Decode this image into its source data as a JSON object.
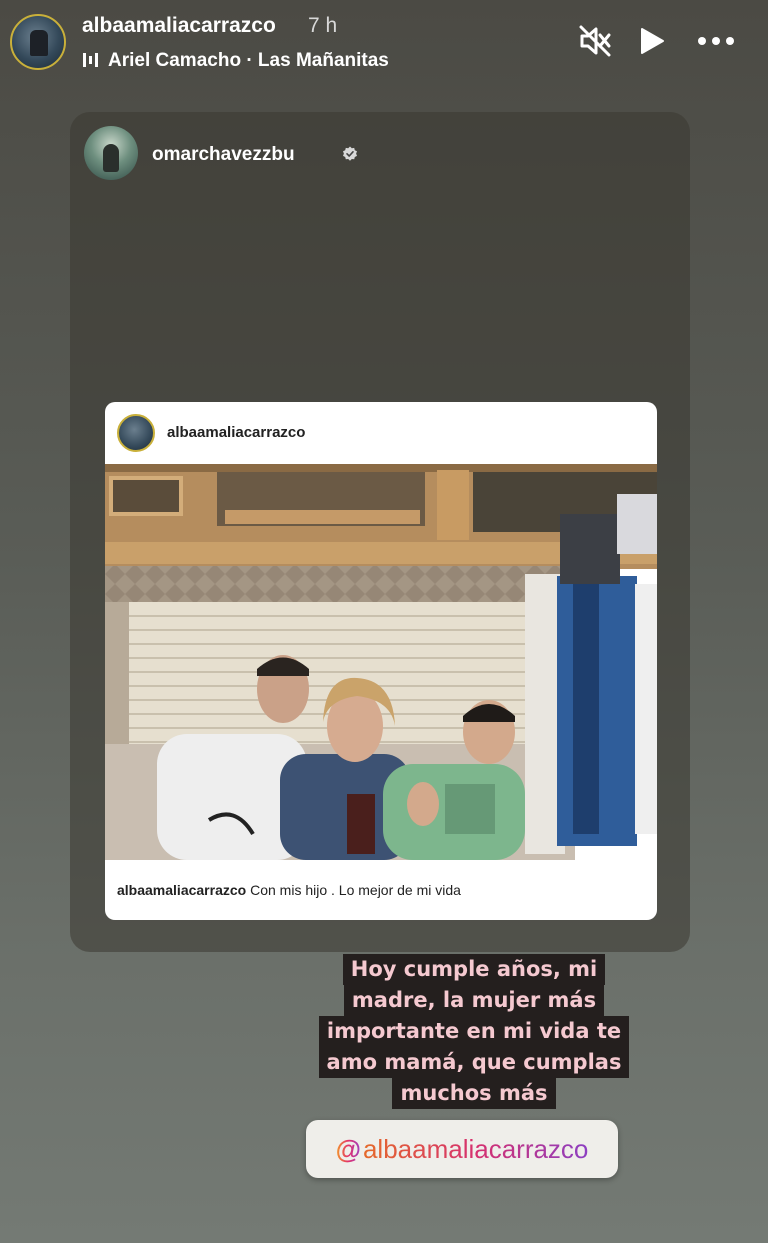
{
  "story": {
    "username": "albaamaliacarrazco",
    "time": "7 h",
    "music": "Ariel Camacho · Las Mañanitas",
    "icons": {
      "mute": "speaker-mute-icon",
      "play": "play-icon",
      "more": "more-options-icon",
      "music": "music-bars-icon"
    }
  },
  "shared_post": {
    "author": "omarchavezzbu",
    "verified": true,
    "embedded": {
      "username": "albaamaliacarrazco",
      "caption_user": "albaamaliacarrazco",
      "caption_text": "Con mis hijo . Lo mejor de mi vida"
    }
  },
  "sticker": {
    "lines": [
      "Hoy cumple años, mi",
      "madre, la mujer más",
      "importante en mi vida te",
      "amo mamá, que cumplas",
      "muchos más"
    ]
  },
  "mention": {
    "at": "@",
    "handle": "albaamaliacarrazco"
  },
  "colors": {
    "sticker_bg": "#241f1e",
    "sticker_text": "#f5c9d0",
    "verified": "#ffffff"
  }
}
